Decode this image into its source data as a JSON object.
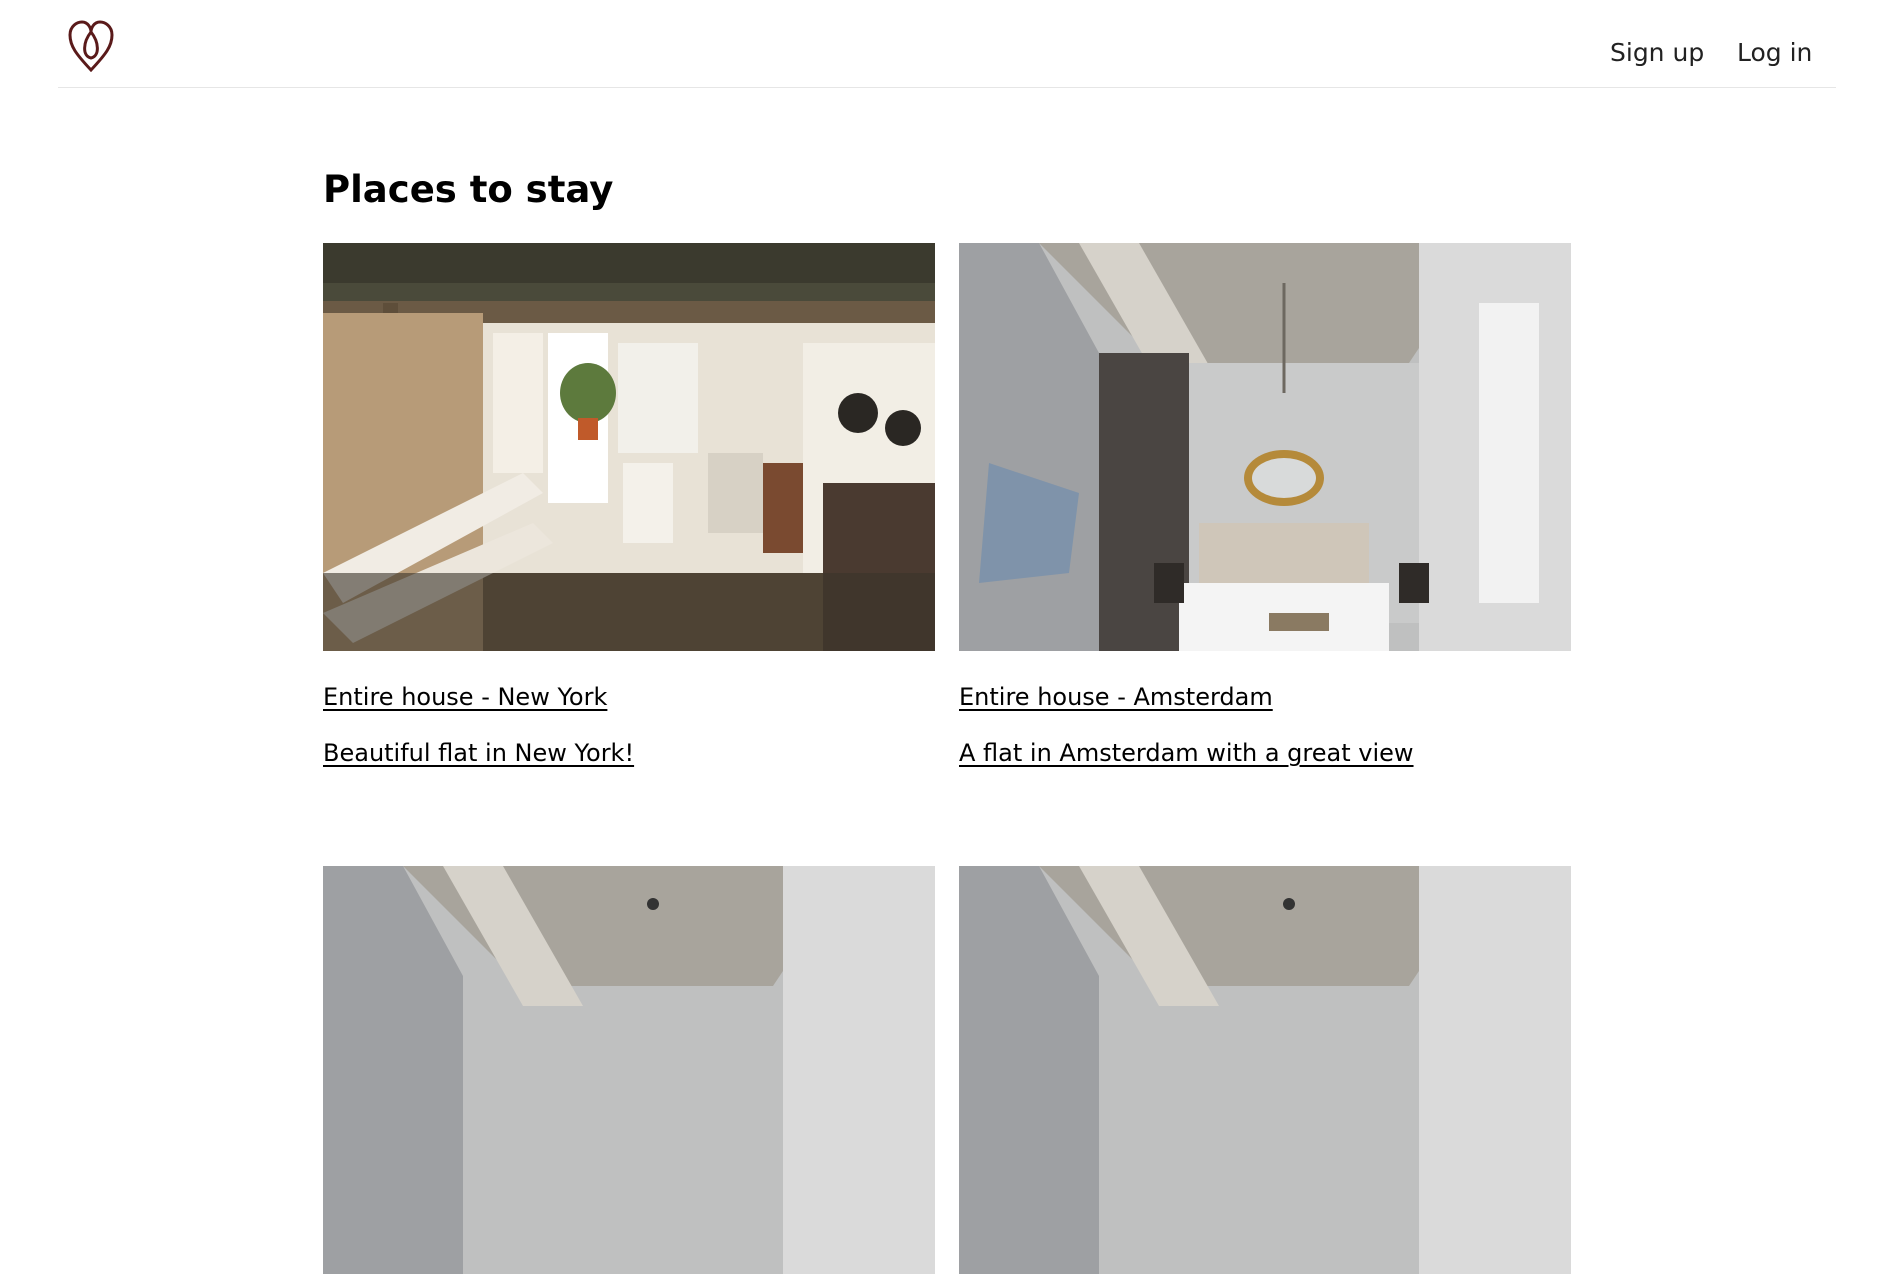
{
  "header": {
    "logo_icon": "heart-logo-icon",
    "signup_label": "Sign up",
    "login_label": "Log in"
  },
  "main": {
    "title": "Places to stay",
    "listings": [
      {
        "title": "Entire house - New York",
        "description": "Beautiful flat in New York!",
        "photo": "cozy-loft-interior-photo"
      },
      {
        "title": "Entire house - Amsterdam",
        "description": "A flat in Amsterdam with a great view",
        "photo": "bedroom-interior-photo"
      },
      {
        "title": "",
        "description": "",
        "photo": "concrete-ceiling-interior-photo"
      },
      {
        "title": "",
        "description": "",
        "photo": "concrete-ceiling-interior-photo"
      }
    ]
  },
  "colors": {
    "logo": "#5a1a1a",
    "text": "#111111",
    "divider": "#e6e6e6"
  }
}
